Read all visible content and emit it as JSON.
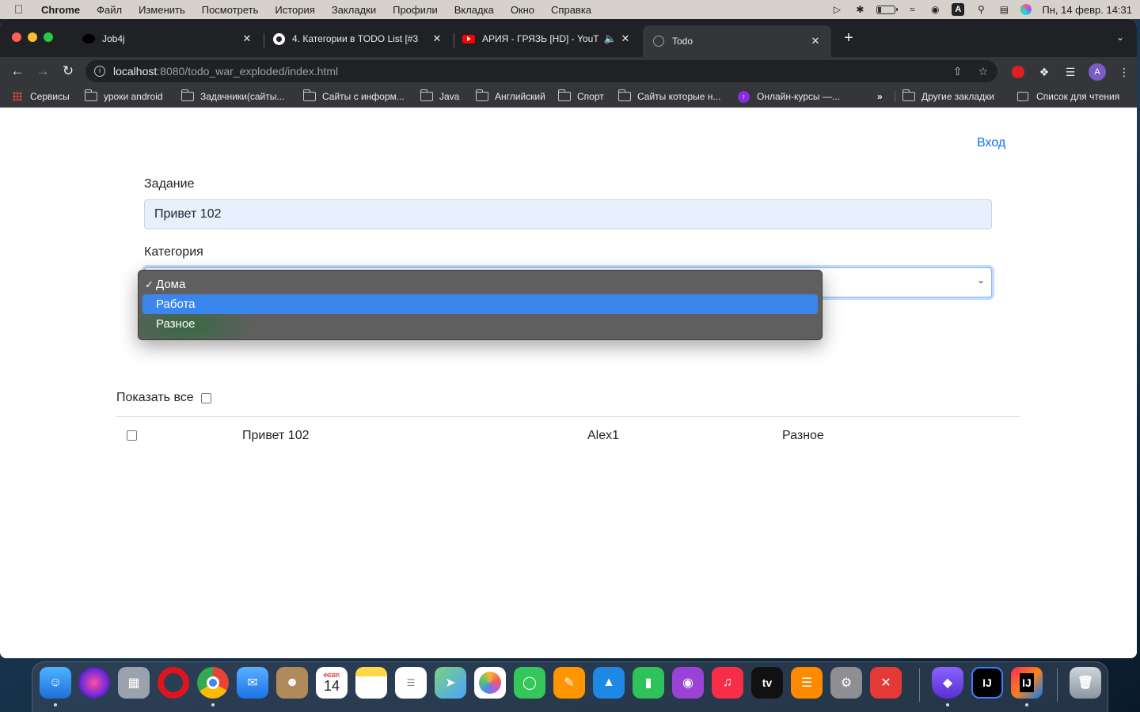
{
  "menubar": {
    "items": [
      "Chrome",
      "Файл",
      "Изменить",
      "Посмотреть",
      "История",
      "Закладки",
      "Профили",
      "Вкладка",
      "Окно",
      "Справка"
    ],
    "input_source": "A",
    "clock": "Пн, 14 февр.  14:31"
  },
  "tabs": [
    {
      "title": "Job4j"
    },
    {
      "title": "4. Категории в TODO List [#3"
    },
    {
      "title": "АРИЯ - ГРЯЗЬ [HD] - YouT"
    },
    {
      "title": "Todo"
    }
  ],
  "address": {
    "host": "localhost",
    "path": ":8080/todo_war_exploded/index.html"
  },
  "profile_initial": "A",
  "bookmarks": [
    {
      "label": "Сервисы"
    },
    {
      "label": "уроки android"
    },
    {
      "label": "Задачники(сайты..."
    },
    {
      "label": "Сайты с информ..."
    },
    {
      "label": "Java"
    },
    {
      "label": "Английский"
    },
    {
      "label": "Спорт"
    },
    {
      "label": "Сайты которые н..."
    },
    {
      "label": "Онлайн-курсы —..."
    },
    {
      "label": "»"
    },
    {
      "label": "Другие закладки"
    },
    {
      "label": "Список для чтения"
    }
  ],
  "page": {
    "login_link": "Вход",
    "task_label": "Задание",
    "task_value": "Привет 102",
    "category_label": "Категория",
    "category_options": [
      "Дома",
      "Работа",
      "Разное"
    ],
    "category_selected": "Дома",
    "category_highlighted": "Работа",
    "show_all_label": "Показать все",
    "rows": [
      {
        "description": "Привет 102",
        "user": "Alex1",
        "category": "Разное"
      }
    ]
  },
  "dock": {
    "calendar_month": "ФЕВР.",
    "calendar_day": "14",
    "tv_label": "tv",
    "ij_label": "IJ"
  },
  "colors": {
    "link": "#0d6efd",
    "autofill_bg": "#e8f0fe",
    "dropdown_bg": "#5f5f5f",
    "dropdown_highlight": "#3b86ed",
    "chrome_dark": "#202124"
  }
}
